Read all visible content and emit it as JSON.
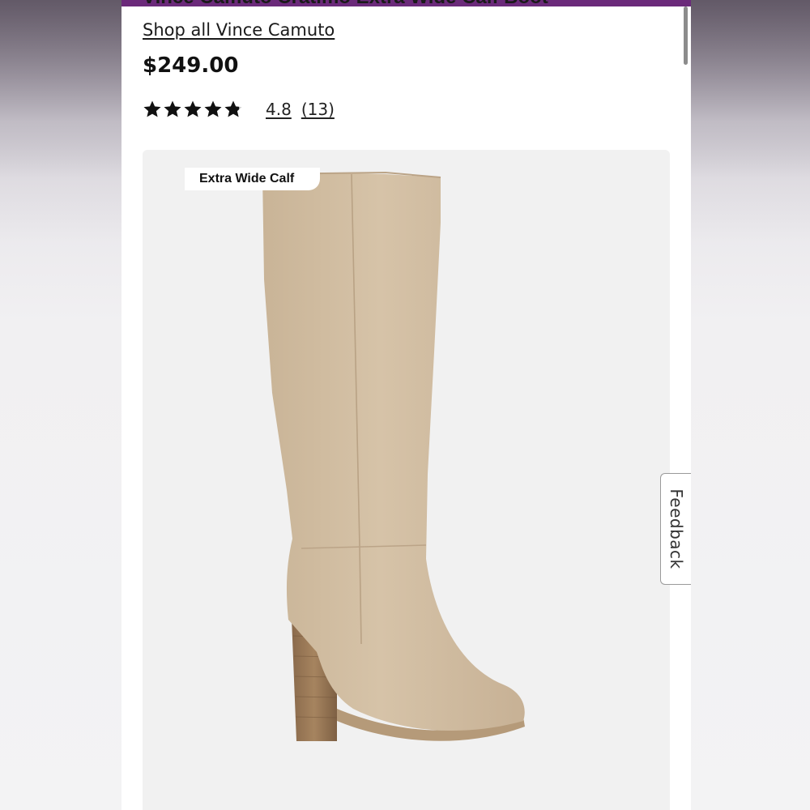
{
  "product": {
    "title_partial": "Vince Camuto Cratimo Extra Wide Calf Boot",
    "shop_all_link": "Shop all Vince Camuto",
    "price": "$249.00",
    "rating": {
      "stars_filled": 4.8,
      "stars_max": 5,
      "value_label": "4.8",
      "count_label": "(13)"
    },
    "badge": "Extra Wide Calf"
  },
  "feedback_tab": {
    "label": "Feedback"
  },
  "colors": {
    "accent_bar": "#6b2a7a",
    "card_bg": "#f1f1f1",
    "boot": "#d2bea2",
    "heel": "#9b7a5a"
  },
  "icons": {
    "star": "star-icon"
  }
}
